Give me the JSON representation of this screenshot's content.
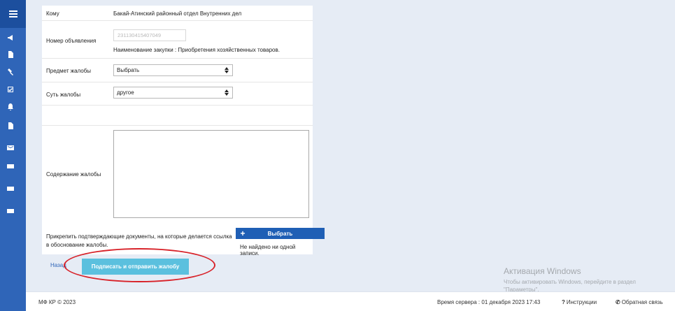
{
  "sidebar": {
    "menu_icon": "hamburger-icon",
    "items": [
      {
        "icon": "megaphone-icon"
      },
      {
        "icon": "document-icon"
      },
      {
        "icon": "gavel-icon"
      },
      {
        "icon": "checkbox-icon"
      },
      {
        "icon": "bell-icon"
      },
      {
        "icon": "file-icon"
      },
      {
        "icon": "envelope-icon"
      },
      {
        "icon": "card-icon"
      },
      {
        "icon": "card-icon"
      },
      {
        "icon": "card-icon"
      }
    ]
  },
  "form": {
    "to_label": "Кому",
    "to_value": "Бакай-Атинский районный отдел Внутренних дел",
    "ad_number_label": "Номер объявления",
    "ad_number_value": "231130415407049",
    "purchase_name": "Наименование закупки : Приобретения хозяйственных товаров.",
    "subject_label": "Предмет жалобы",
    "subject_value": "Выбрать",
    "essence_label": "Суть жалобы",
    "essence_value": "другое",
    "content_label": "Содержание жалобы",
    "content_value": "",
    "attach_label": "Прикрепить подтверждающие документы, на которые делается ссылка в обоснование жалобы.",
    "choose_button": "Выбрать",
    "no_records": "Не найдено ни одной записи."
  },
  "actions": {
    "back_label": "Назад",
    "submit_label": "Подписать и отправить жалобу"
  },
  "watermark": {
    "title": "Активация Windows",
    "subtitle": "Чтобы активировать Windows, перейдите в раздел \"Параметры\"."
  },
  "footer": {
    "copyright": "МФ КР © 2023",
    "server_time": "Время сервера : 01 декабря 2023 17:43",
    "help": "Инструкции",
    "feedback": "Обратная связь"
  },
  "colors": {
    "sidebar": "#2f65b8",
    "primary_button": "#1f5fb5",
    "submit_button": "#5bc0de",
    "highlight": "#d8232a"
  }
}
